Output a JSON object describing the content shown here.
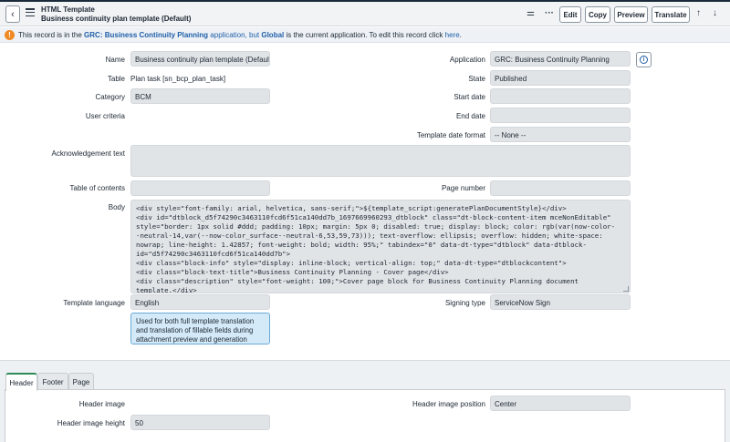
{
  "header": {
    "record_type": "HTML Template",
    "record_name": "Business continuity plan template (Default)",
    "buttons": {
      "edit": "Edit",
      "copy": "Copy",
      "preview": "Preview",
      "translate": "Translate"
    },
    "icons": {
      "back": "‹",
      "settings": "⚌",
      "more": "···",
      "up": "↑",
      "down": "↓"
    }
  },
  "banner": {
    "icon": "!",
    "text_1": "This record is in the",
    "app_name": "GRC: Business Continuity Planning",
    "text_2": "application, but",
    "current_app": "Global",
    "text_3": "is the current application. To edit this record click",
    "link": "here",
    "text_4": "."
  },
  "form": {
    "name_label": "Name",
    "name_value": "Business continuity plan template (Default)",
    "table_label": "Table",
    "table_value": "Plan task [sn_bcp_plan_task]",
    "category_label": "Category",
    "category_value": "BCM",
    "user_criteria_label": "User criteria",
    "ack_label": "Acknowledgement text",
    "toc_label": "Table of contents",
    "body_label": "Body",
    "body_value": "<div style=\"font-family: arial, helvetica, sans-serif;\">${template_script:generatePlanDocumentStyle}</div>\n<div id=\"dtblock_d5f74290c3463110fcd6f51ca140dd7b_1697669960293_dtblock\" class=\"dt-block-content-item mceNonEditable\"\nstyle=\"border: 1px solid #ddd; padding: 10px; margin: 5px 0; disabled: true; display: block; color: rgb(var(now-color-\n-neutral-14,var(--now-color_surface--neutral-6,53,59,73))); text-overflow: ellipsis; overflow: hidden; white-space:\nnowrap; line-height: 1.42857; font-weight: bold; width: 95%;\" tabindex=\"0\" data-dt-type=\"dtblock\" data-dtblock-\nid=\"d5f74290c3463110fcd6f51ca140dd7b\">\n<div class=\"block-info\" style=\"display: inline-block; vertical-align: top;\" data-dt-type=\"dtblockcontent\">\n<div class=\"block-text-title\">Business Continuity Planning - Cover page</div>\n<div class=\"description\" style=\"font-weight: 100;\">Cover page block for Business Continuity Planning document\ntemplate.</div>\n</div>",
    "template_language_label": "Template language",
    "template_language_value": "English",
    "language_tooltip": "Used for both full template translation and translation of fillable fields during attachment preview and generation",
    "application_label": "Application",
    "application_value": "GRC: Business Continuity Planning",
    "state_label": "State",
    "state_value": "Published",
    "start_date_label": "Start date",
    "end_date_label": "End date",
    "date_format_label": "Template date format",
    "date_format_value": "-- None --",
    "page_number_label": "Page number",
    "signing_type_label": "Signing type",
    "signing_type_value": "ServiceNow Sign"
  },
  "tabs": [
    "Header",
    "Footer",
    "Page"
  ],
  "header_tab": {
    "image_label": "Header image",
    "image_height_label": "Header image height",
    "image_height_value": "50",
    "image_position_label": "Header image position",
    "image_position_value": "Center"
  },
  "colors": {
    "accent": "#2e8b57",
    "link": "#1f5ea8",
    "warning": "#f08a24",
    "field_bg": "#e1e4e7",
    "tooltip_bg": "#d5eaf8"
  }
}
